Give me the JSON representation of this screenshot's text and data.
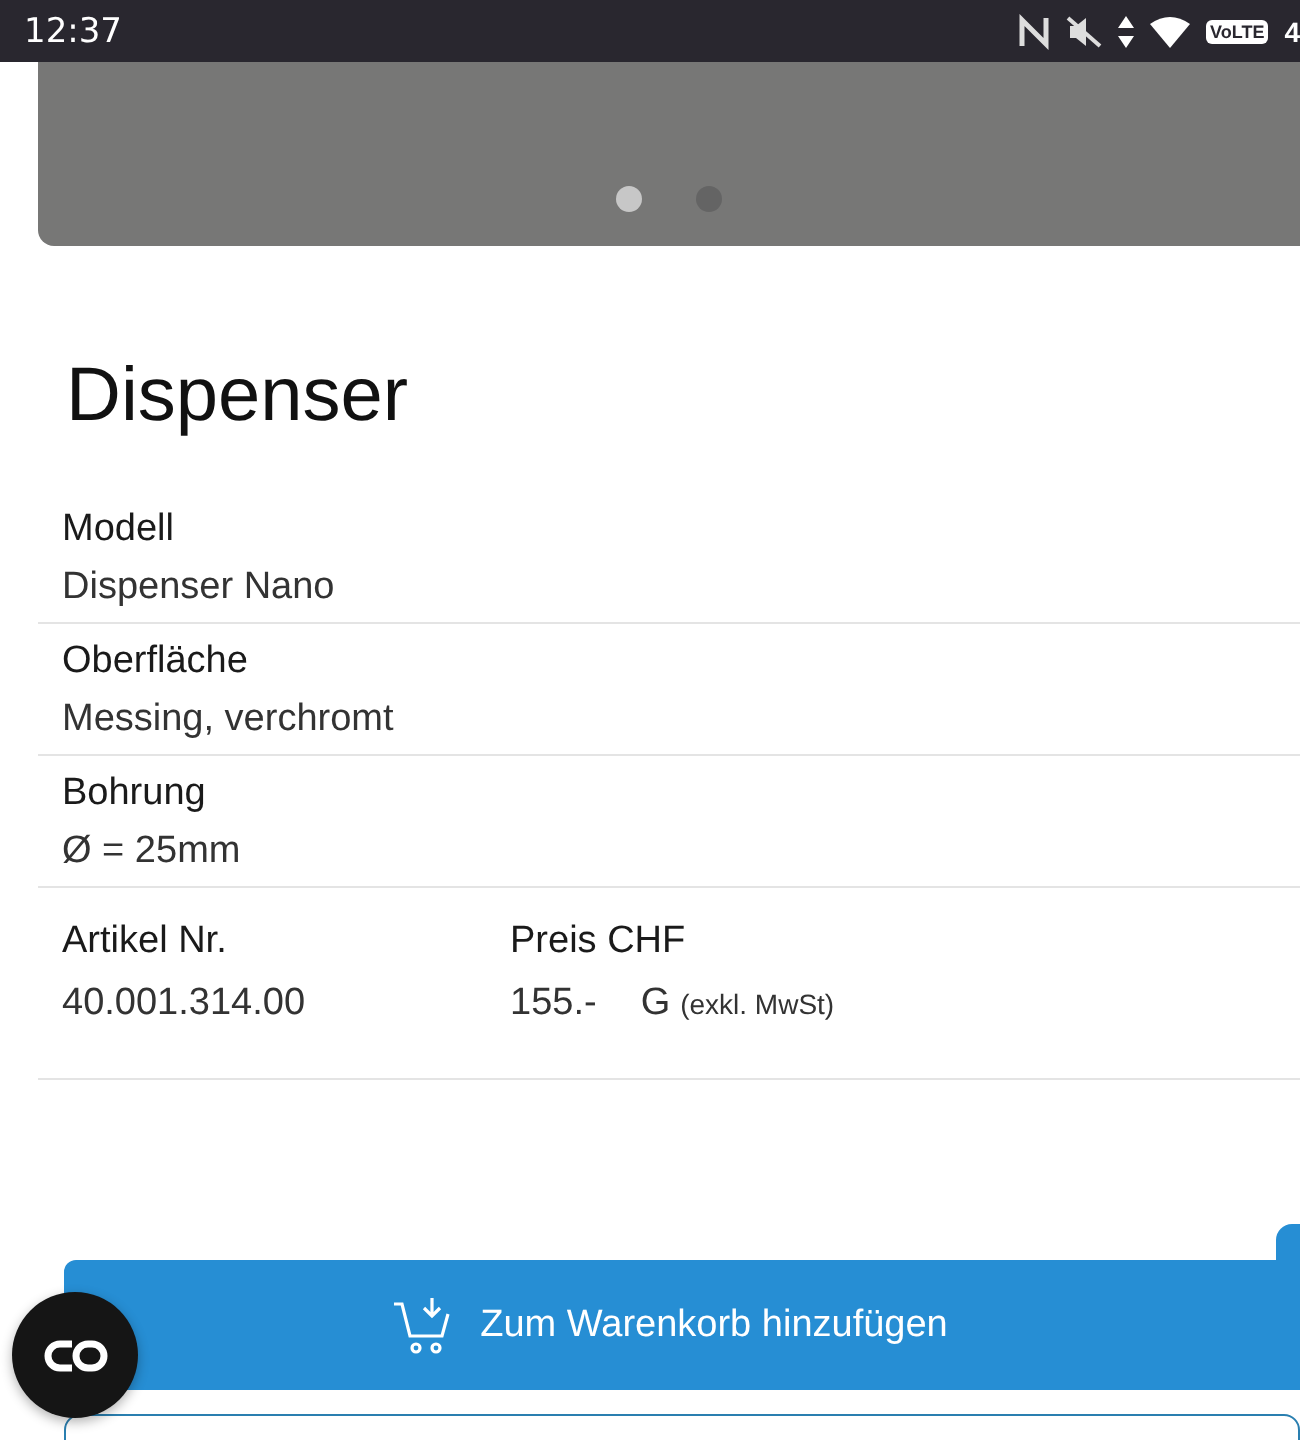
{
  "status_bar": {
    "time": "12:37",
    "network_badge": "VoLTE",
    "network_type": "4"
  },
  "carousel": {
    "dots": [
      {
        "selected": true
      },
      {
        "selected": false
      }
    ]
  },
  "title": "Dispenser",
  "specs": [
    {
      "label": "Modell",
      "value": "Dispenser Nano"
    },
    {
      "label": "Oberfläche",
      "value": "Messing, verchromt"
    },
    {
      "label": "Bohrung",
      "value": "Ø = 25mm"
    }
  ],
  "article": {
    "label": "Artikel Nr.",
    "value": "40.001.314.00"
  },
  "price": {
    "label": "Preis CHF",
    "value": "155.-",
    "code": "G",
    "note": "(exkl. MwSt)"
  },
  "cart_button": {
    "label": "Zum Warenkorb hinzufügen"
  }
}
